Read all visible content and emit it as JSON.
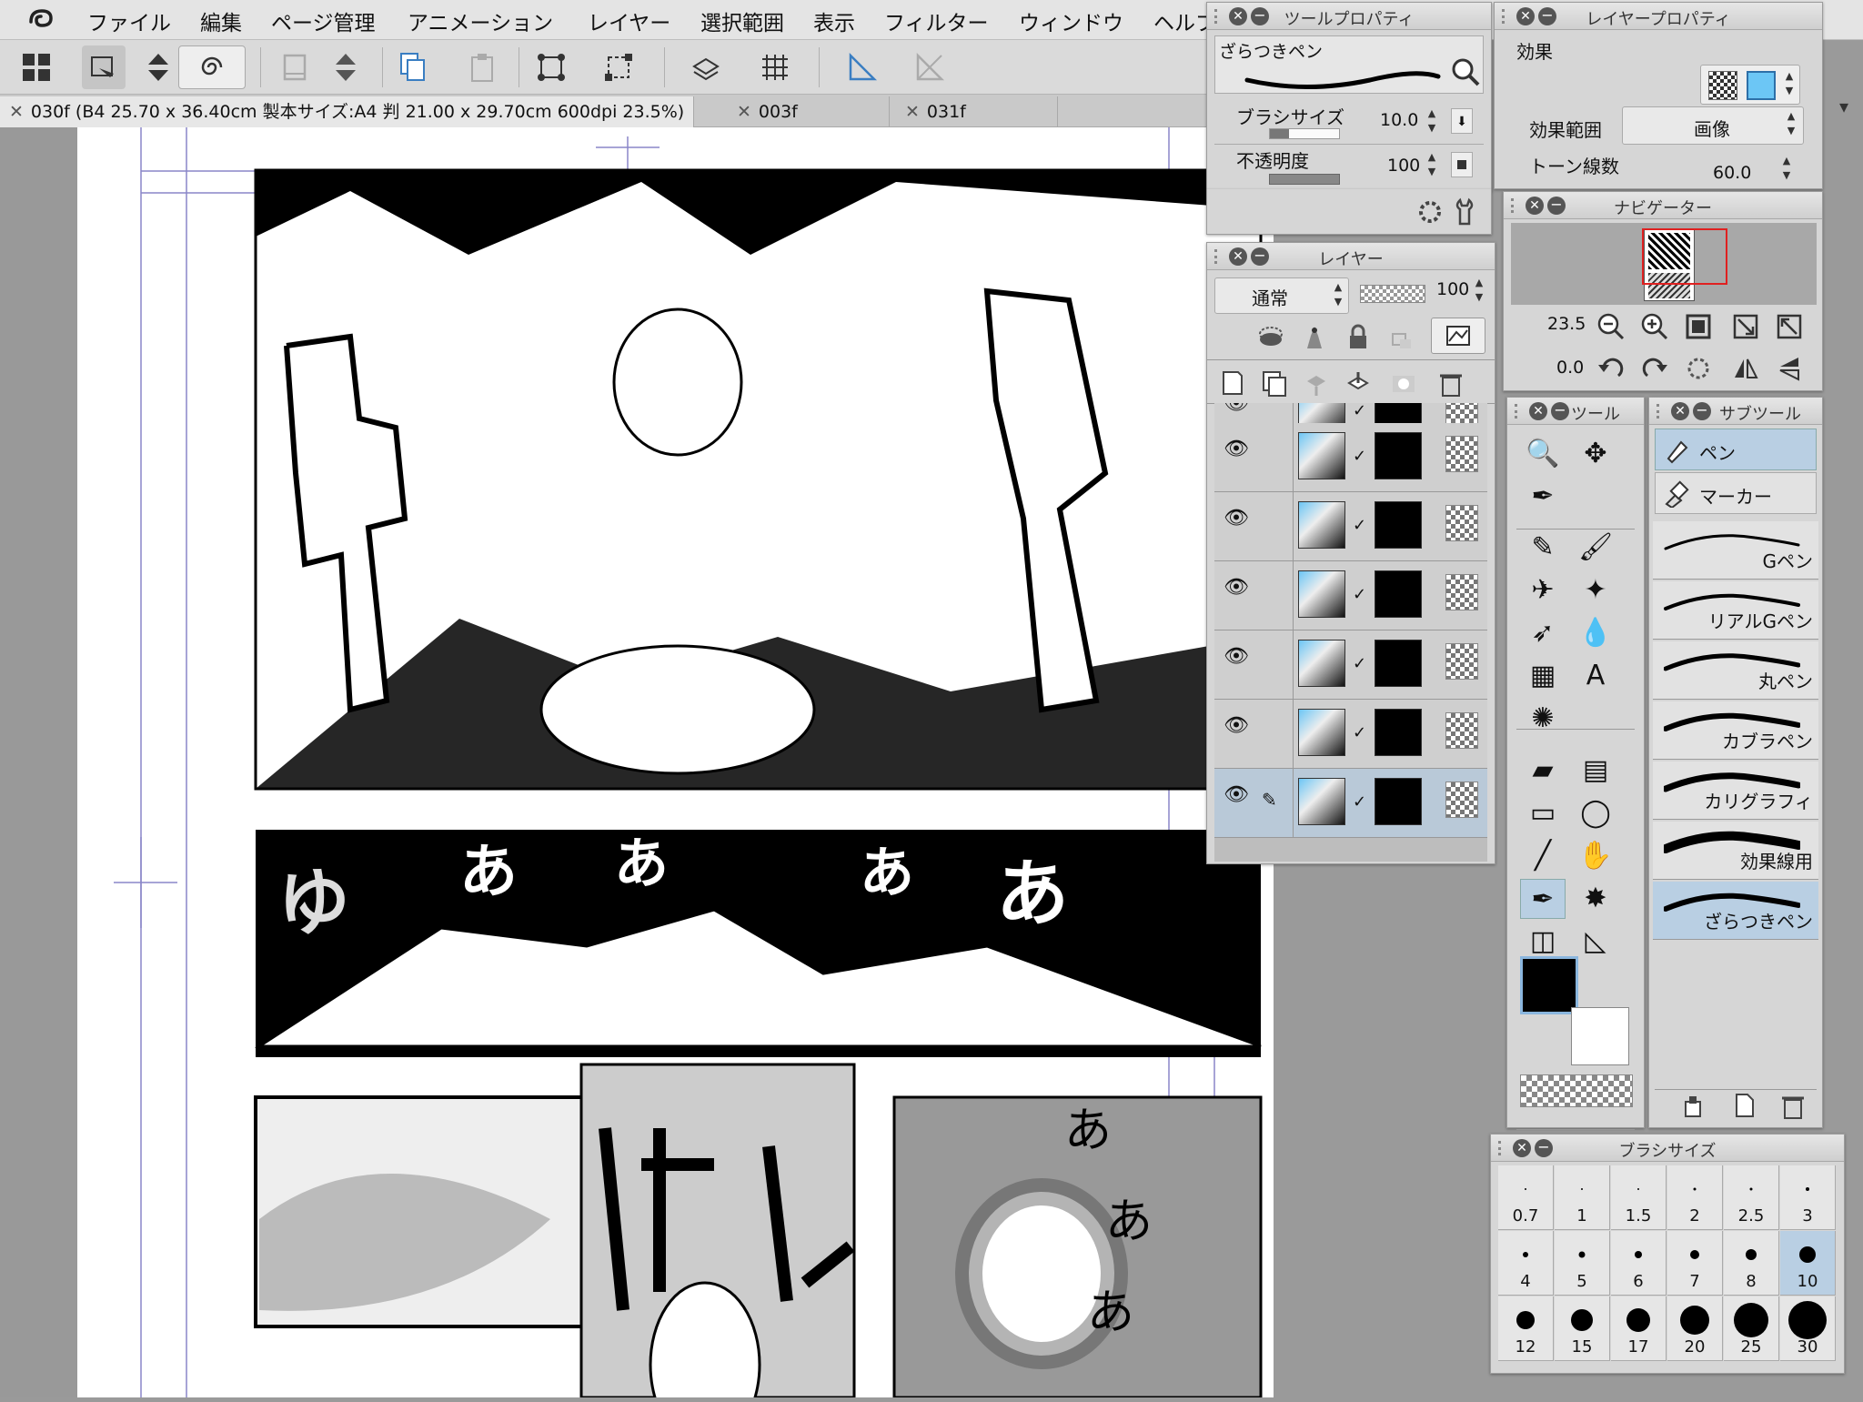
{
  "menubar": {
    "items": [
      "ファイル",
      "編集",
      "ページ管理",
      "アニメーション",
      "レイヤー",
      "選択範囲",
      "表示",
      "フィルター",
      "ウィンドウ",
      "ヘルプ"
    ]
  },
  "tabs": [
    {
      "label": "030f (B4 25.70 x 36.40cm 製本サイズ:A4 判 21.00 x 29.70cm 600dpi 23.5%)"
    },
    {
      "label": "003f"
    },
    {
      "label": "031f"
    }
  ],
  "tool_property": {
    "title": "ツールプロパティ",
    "tool_name": "ざらつきペン",
    "brush_size_label": "ブラシサイズ",
    "brush_size_value": "10.0",
    "opacity_label": "不透明度",
    "opacity_value": "100"
  },
  "layer_property": {
    "title": "レイヤープロパティ",
    "effect_label": "効果",
    "range_label": "効果範囲",
    "range_value": "画像",
    "tone_label": "トーン線数",
    "tone_value": "60.0"
  },
  "navigator": {
    "title": "ナビゲーター",
    "zoom": "23.5",
    "rotation": "0.0"
  },
  "layers": {
    "title": "レイヤー",
    "blend_mode": "通常",
    "opacity": "100"
  },
  "tools": {
    "title": "ツール"
  },
  "subtool": {
    "title": "サブツール",
    "groups": [
      "ペン",
      "マーカー"
    ],
    "items": [
      "Gペン",
      "リアルGペン",
      "丸ペン",
      "カブラペン",
      "カリグラフィ",
      "効果線用",
      "ざらつきペン"
    ],
    "selected": "ざらつきペン"
  },
  "brush_size": {
    "title": "ブラシサイズ",
    "sizes": [
      "0.7",
      "1",
      "1.5",
      "2",
      "2.5",
      "3",
      "4",
      "5",
      "6",
      "7",
      "8",
      "10",
      "12",
      "15",
      "17",
      "20",
      "25",
      "30"
    ],
    "selected": "10"
  },
  "colors": {
    "accent": "#6cc6f5",
    "selection": "#b9cfe3"
  }
}
